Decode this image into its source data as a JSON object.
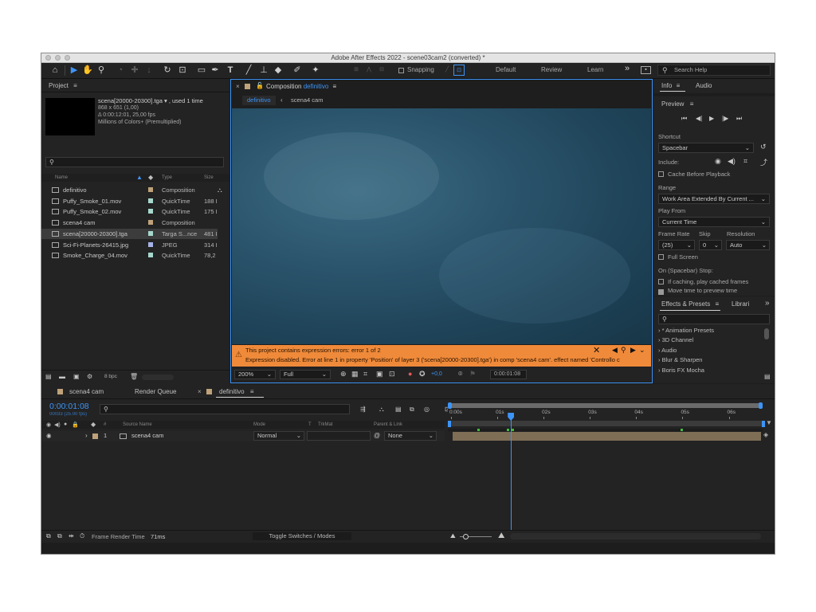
{
  "window": {
    "title": "Adobe After Effects 2022 - scene03cam2 (converted) *"
  },
  "toolbar": {
    "snapping_label": "Snapping",
    "workspaces": [
      "Default",
      "Review",
      "Learn"
    ],
    "more_label": "»",
    "search_placeholder": "Search Help"
  },
  "project": {
    "tab_label": "Project",
    "footage_name": "scena[20000-20300].tga ▾ , used 1 time",
    "footage_dims": "868 x 651 (1,00)",
    "footage_duration": "Δ 0:00:12:01, 25,00 fps",
    "footage_colors": "Millions of Colors+ (Premultiplied)",
    "columns": {
      "name": "Name",
      "type": "Type",
      "size": "Size"
    },
    "items": [
      {
        "name": "definitivo",
        "type": "Composition",
        "size": "",
        "label_color": "#bfa27a"
      },
      {
        "name": "Puffy_Smoke_01.mov",
        "type": "QuickTime",
        "size": "188 I",
        "label_color": "#a6d7cc"
      },
      {
        "name": "Puffy_Smoke_02.mov",
        "type": "QuickTime",
        "size": "175 I",
        "label_color": "#a6d7cc"
      },
      {
        "name": "scena4 cam",
        "type": "Composition",
        "size": "",
        "label_color": "#bfa27a"
      },
      {
        "name": "scena[20000-20300].tga",
        "type": "Targa S...nce",
        "size": "481 I",
        "label_color": "#a6d7cc"
      },
      {
        "name": "Sci-Fi-Planets-26415.jpg",
        "type": "JPEG",
        "size": "314 I",
        "label_color": "#a6b2e6"
      },
      {
        "name": "Smoke_Charge_04.mov",
        "type": "QuickTime",
        "size": "78,2",
        "label_color": "#a6d7cc"
      }
    ],
    "bpc_label": "8 bpc"
  },
  "composition": {
    "tab_prefix": "Composition",
    "tab_name": "definitivo",
    "breadcrumbs": [
      "definitivo",
      "scena4 cam"
    ],
    "error_title": "This project contains expression errors: error 1 of 2",
    "error_detail": "Expression disabled. Error at line 1 in property 'Position' of layer 3 ('scena[20000-20300].tga') in comp 'scena4 cam'. effect named 'Controllo c",
    "zoom": "200%",
    "resolution": "Full",
    "exposure": "+0,0",
    "timecode": "0:00:01:08"
  },
  "info_panel": {
    "tabs": [
      "Info",
      "Audio"
    ]
  },
  "preview": {
    "title": "Preview",
    "shortcut_label": "Shortcut",
    "shortcut_value": "Spacebar",
    "include_label": "Include:",
    "cache_label": "Cache Before Playback",
    "range_label": "Range",
    "range_value": "Work Area Extended By Current ...",
    "play_from_label": "Play From",
    "play_from_value": "Current Time",
    "frame_rate_label": "Frame Rate",
    "skip_label": "Skip",
    "resolution_label": "Resolution",
    "frame_rate_value": "(25)",
    "skip_value": "0",
    "resolution_value": "Auto",
    "full_screen_label": "Full Screen",
    "on_stop_label": "On (Spacebar) Stop:",
    "cached_label": "If caching, play cached frames",
    "move_time_label": "Move time to preview time"
  },
  "effects": {
    "tabs": [
      "Effects & Presets",
      "Librari"
    ],
    "categories": [
      "* Animation Presets",
      "3D Channel",
      "Audio",
      "Blur & Sharpen",
      "Boris FX Mocha"
    ]
  },
  "timeline": {
    "tabs": [
      "scena4 cam",
      "Render Queue",
      "definitivo"
    ],
    "timecode": "0:00:01:08",
    "frame_info": "00033 (25.00 fps)",
    "col_hash": "#",
    "col_source": "Source Name",
    "col_mode": "Mode",
    "col_t": "T",
    "col_trkmat": "TrkMat",
    "col_parent": "Parent & Link",
    "layer": {
      "number": "1",
      "name": "scena4 cam",
      "mode": "Normal",
      "parent": "None"
    },
    "ruler": [
      "0:00s",
      "01s",
      "02s",
      "03s",
      "04s",
      "05s",
      "06s"
    ],
    "playhead_seconds": 1.32,
    "duration_seconds": 6.8
  },
  "status": {
    "frame_render_label": "Frame Render Time",
    "frame_render_value": "71ms",
    "toggle_label": "Toggle Switches / Modes"
  }
}
